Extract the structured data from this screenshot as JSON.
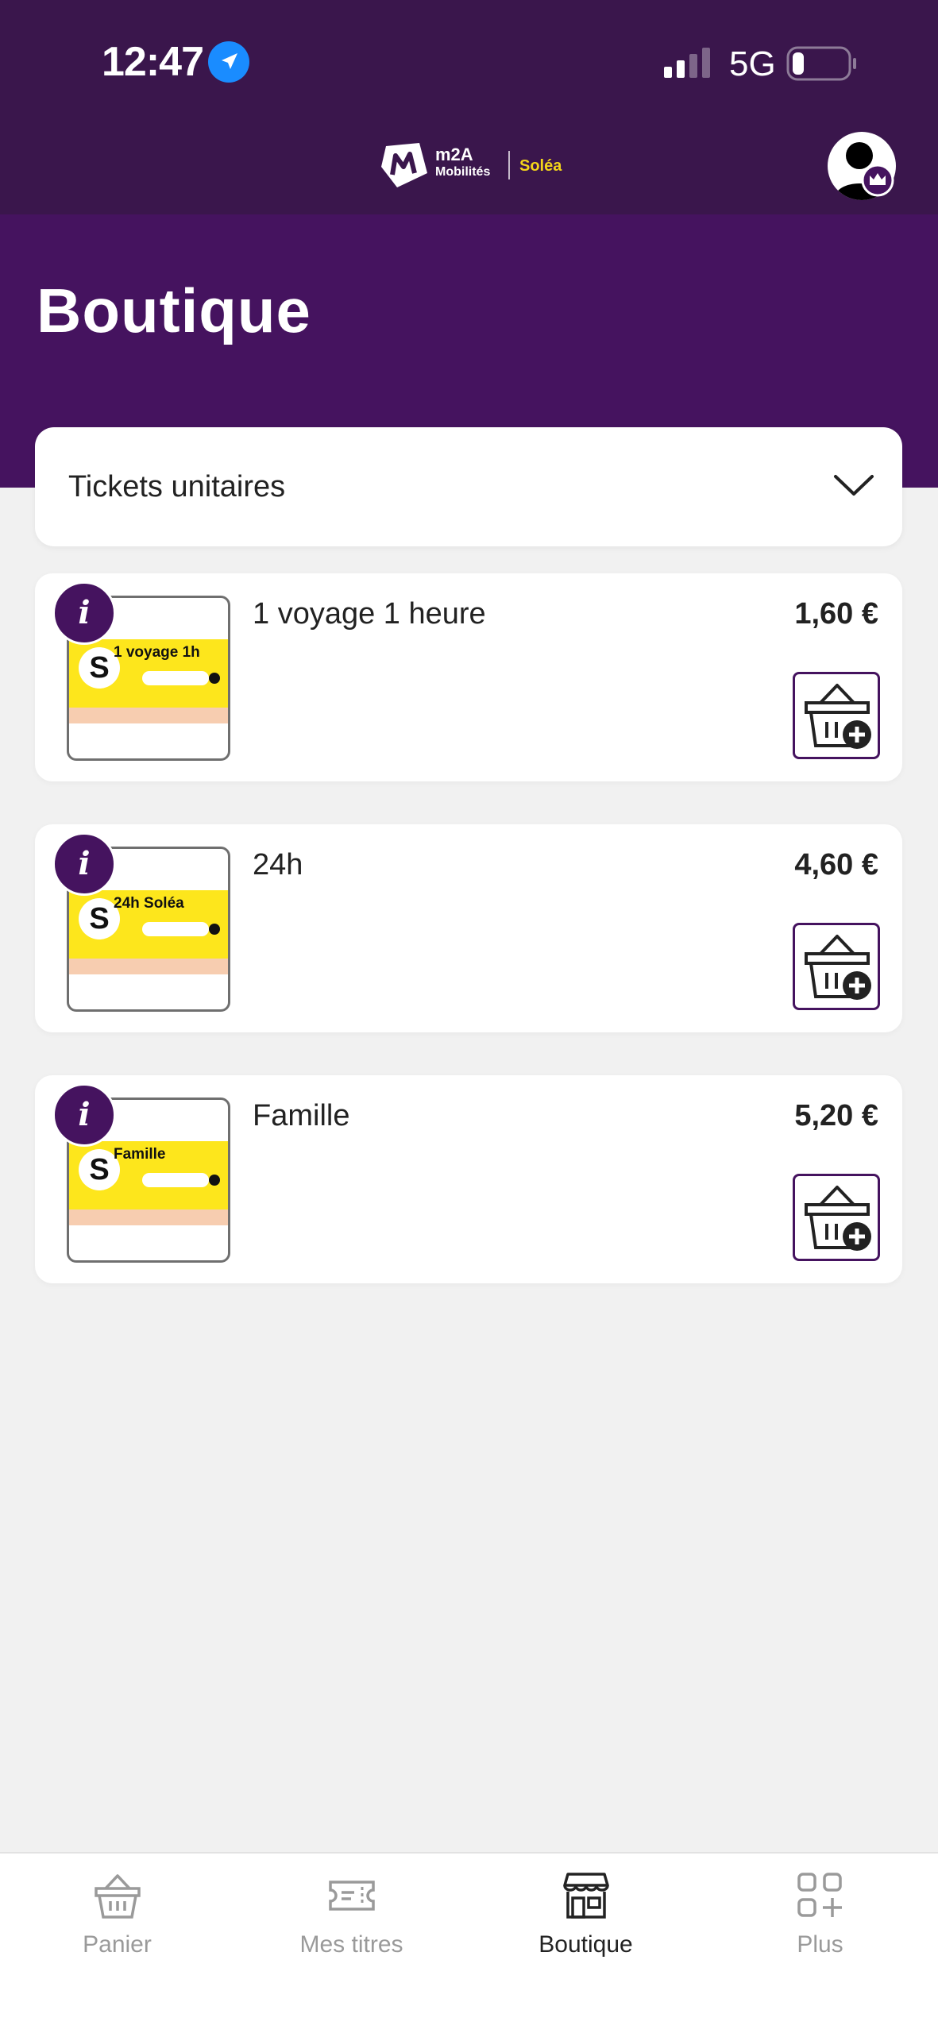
{
  "status_bar": {
    "time": "12:47",
    "network": "5G",
    "icons": [
      "location-arrow-icon",
      "signal-icon",
      "battery-icon"
    ]
  },
  "brand": {
    "name": "m2A",
    "sub": "Mobilités",
    "partner": "Soléa",
    "colors": {
      "primary": "#45135f",
      "topbar": "#3a164c",
      "accent_yellow": "#f3d51a"
    }
  },
  "header": {
    "title": "Boutique"
  },
  "category_select": {
    "value": "Tickets unitaires"
  },
  "products": [
    {
      "name": "1 voyage 1 heure",
      "price": "1,60 €",
      "thumb_text": "1 voyage 1h"
    },
    {
      "name": "24h",
      "price": "4,60 €",
      "thumb_text": "24h Soléa"
    },
    {
      "name": "Famille",
      "price": "5,20 €",
      "thumb_text": "Famille"
    }
  ],
  "tabs": [
    {
      "label": "Panier",
      "icon": "basket-icon",
      "active": false
    },
    {
      "label": "Mes titres",
      "icon": "ticket-icon",
      "active": false
    },
    {
      "label": "Boutique",
      "icon": "store-icon",
      "active": true
    },
    {
      "label": "Plus",
      "icon": "grid-plus-icon",
      "active": false
    }
  ]
}
